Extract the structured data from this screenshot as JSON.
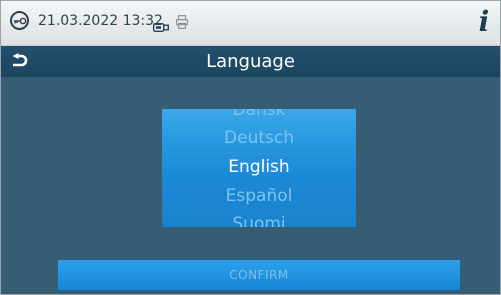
{
  "status_bar": {
    "datetime": "21.03.2022  13:32",
    "icons": [
      "key-icon",
      "usb-icon",
      "printer-icon",
      "info-icon"
    ],
    "info_glyph": "i"
  },
  "header": {
    "title": "Language",
    "back_icon": "back-arrow-icon"
  },
  "language_picker": {
    "options": [
      "Dansk",
      "Deutsch",
      "English",
      "Español",
      "Suomi"
    ],
    "selected": "English"
  },
  "confirm_button": {
    "label": "CONFIRM"
  },
  "colors": {
    "header_bg": "#1f4a66",
    "panel_bg": "#355e75",
    "accent": "#1c8ad6",
    "text_dim": "#7cc4f0"
  }
}
